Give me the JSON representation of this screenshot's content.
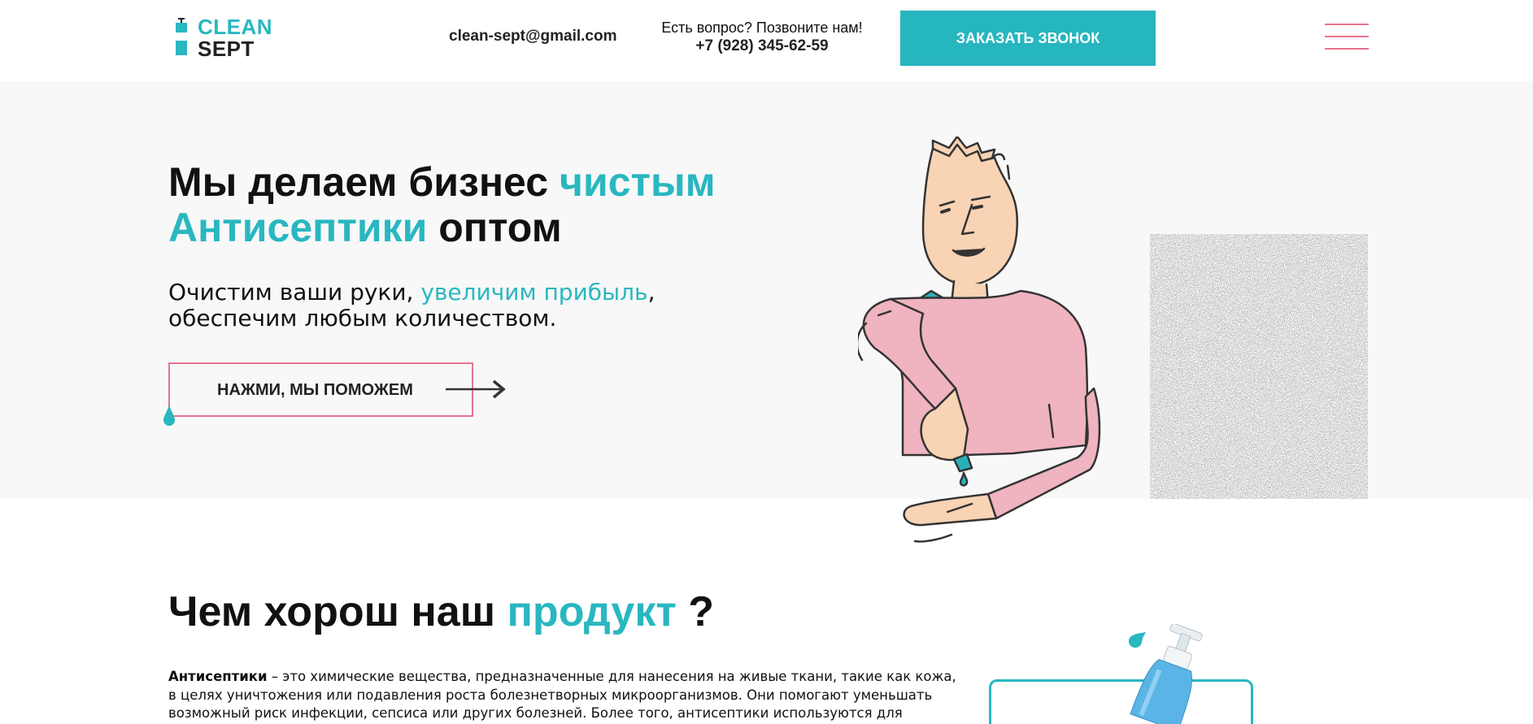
{
  "header": {
    "logo": {
      "line1": "CLEAN",
      "line2": "SEPT"
    },
    "email": "clean-sept@gmail.com",
    "phone_question": "Есть вопрос? Позвоните нам!",
    "phone_number": "+7 (928) 345-62-59",
    "callback_button": "ЗАКАЗАТЬ ЗВОНОК"
  },
  "hero": {
    "title_part1": "Мы делаем бизнес ",
    "title_accent1": "чистым",
    "title_accent2": "Антисептики",
    "title_part2": " оптом",
    "sub_part1": "Очистим ваши руки, ",
    "sub_accent": "увеличим прибыль",
    "sub_part2": ",",
    "sub_line2": "обеспечим любым количеством.",
    "button_label": "НАЖМИ, МЫ ПОМОЖЕМ"
  },
  "product": {
    "title_part1": "Чем хорош наш ",
    "title_accent": "продукт",
    "title_part2": " ?",
    "text_bold": "Антисептики",
    "text_line1": " – это химические вещества, предназначенные для нанесения на живые ткани, такие как кожа,",
    "text_line2": "в целях уничтожения или подавления роста болезнетворных микроорганизмов. Они помогают уменьшать",
    "text_line3": "возможный риск инфекции, сепсиса или других болезней. Более того, антисептики используются для"
  },
  "colors": {
    "accent": "#29b7c0",
    "pink": "#e7738c",
    "hero_bg": "#f8f8f8",
    "shirt": "#f0b3c0",
    "skin": "#f8d3b4"
  }
}
